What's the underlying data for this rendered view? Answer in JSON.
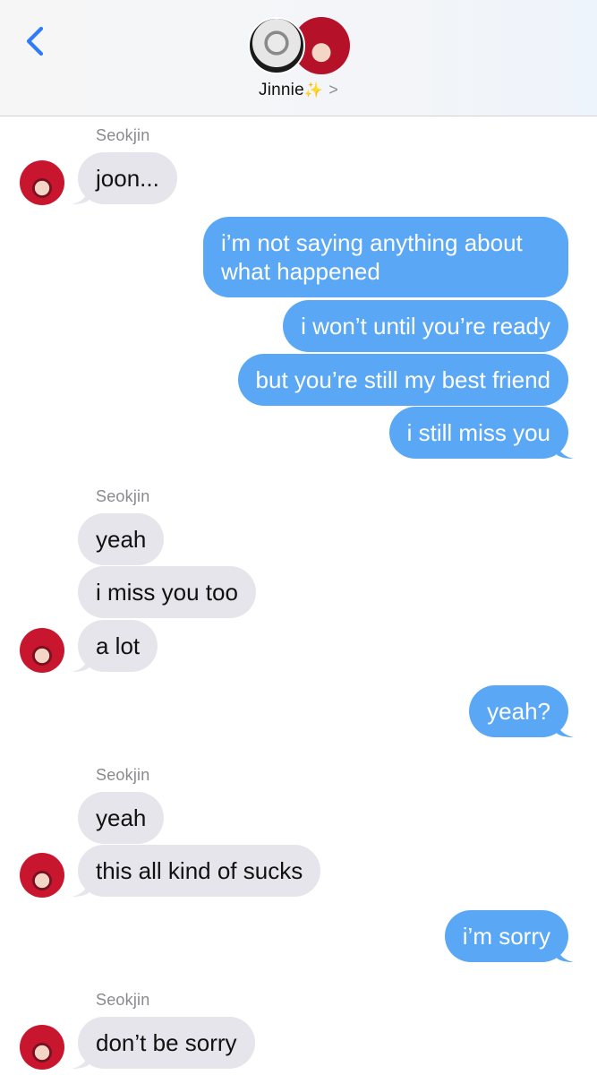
{
  "header": {
    "contact_name": "Jinnie",
    "name_emoji": "✨",
    "chevron": ">"
  },
  "messages": [
    {
      "sender_label": "Seokjin"
    },
    {
      "text": "joon..."
    },
    {
      "text": "i’m not saying anything about what happened"
    },
    {
      "text": "i won’t until you’re ready"
    },
    {
      "text": "but you’re still my best friend"
    },
    {
      "text": "i still miss you"
    },
    {
      "sender_label": "Seokjin"
    },
    {
      "text": "yeah"
    },
    {
      "text": "i miss you too"
    },
    {
      "text": "a lot"
    },
    {
      "text": "yeah?"
    },
    {
      "sender_label": "Seokjin"
    },
    {
      "text": "yeah"
    },
    {
      "text": "this all kind of sucks"
    },
    {
      "text": "i’m sorry"
    },
    {
      "sender_label": "Seokjin"
    },
    {
      "text": "don’t be sorry"
    }
  ],
  "colors": {
    "incoming_bubble": "#e6e5eb",
    "outgoing_bubble": "#5aa8f5",
    "accent_back": "#2f7cf6"
  }
}
